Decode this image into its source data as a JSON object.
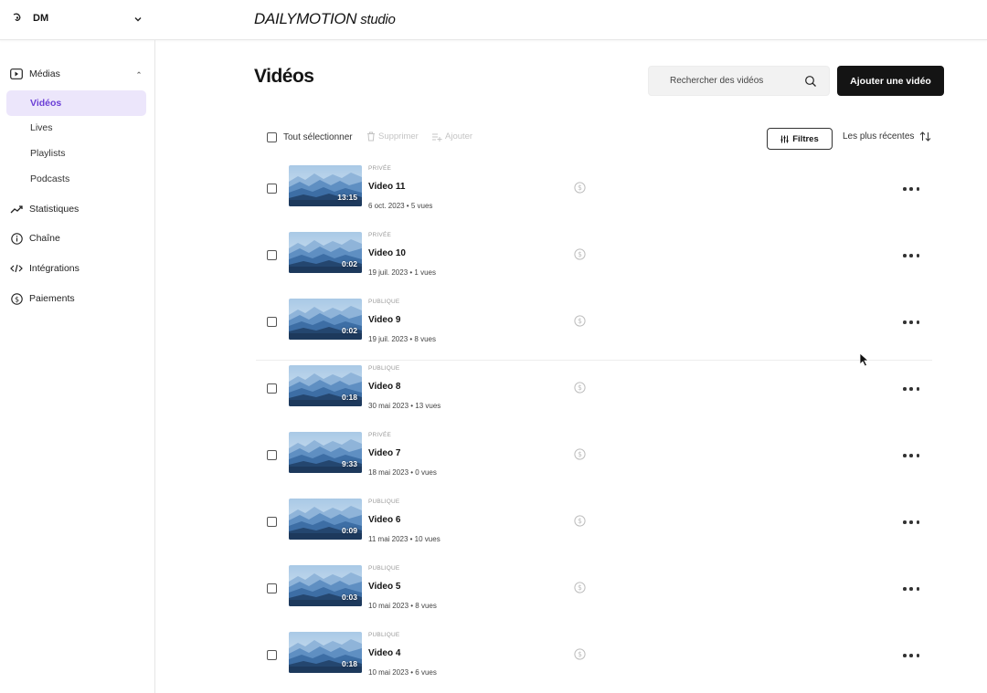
{
  "account": {
    "name": "DM",
    "logo_icon": "dailymotion-mark-icon"
  },
  "brand": {
    "part1": "DAILYMOTION",
    "part2": "studio"
  },
  "sidebar": {
    "items": [
      {
        "label": "Médias",
        "icon": "play-square-icon"
      },
      {
        "label": "Statistiques",
        "icon": "trend-up-icon"
      },
      {
        "label": "Chaîne",
        "icon": "info-circle-icon"
      },
      {
        "label": "Intégrations",
        "icon": "code-icon"
      },
      {
        "label": "Paiements",
        "icon": "dollar-circle-icon"
      }
    ],
    "sub_items": [
      {
        "label": "Vidéos",
        "active": true
      },
      {
        "label": "Lives"
      },
      {
        "label": "Playlists"
      },
      {
        "label": "Podcasts"
      }
    ]
  },
  "main": {
    "title": "Vidéos",
    "search_placeholder": "Rechercher des vidéos",
    "add_button": "Ajouter une vidéo",
    "toolbar": {
      "select_all": "Tout sélectionner",
      "delete": "Supprimer",
      "add": "Ajouter",
      "filters": "Filtres",
      "sort": "Les plus récentes"
    },
    "videos": [
      {
        "visibility": "PRIVÉE",
        "title": "Video 11",
        "meta": "6 oct. 2023 • 5 vues",
        "duration": "13:15"
      },
      {
        "visibility": "PRIVÉE",
        "title": "Video 10",
        "meta": "19 juil. 2023 • 1 vues",
        "duration": "0:02"
      },
      {
        "visibility": "PUBLIQUE",
        "title": "Video 9",
        "meta": "19 juil. 2023 • 8 vues",
        "duration": "0:02"
      },
      {
        "visibility": "PUBLIQUE",
        "title": "Video 8",
        "meta": "30 mai 2023 • 13 vues",
        "duration": "0:18"
      },
      {
        "visibility": "PRIVÉE",
        "title": "Video 7",
        "meta": "18 mai 2023 • 0 vues",
        "duration": "9:33"
      },
      {
        "visibility": "PUBLIQUE",
        "title": "Video 6",
        "meta": "11 mai 2023 • 10 vues",
        "duration": "0:09"
      },
      {
        "visibility": "PUBLIQUE",
        "title": "Video 5",
        "meta": "10 mai 2023 • 8 vues",
        "duration": "0:03"
      },
      {
        "visibility": "PUBLIQUE",
        "title": "Video 4",
        "meta": "10 mai 2023 • 6 vues",
        "duration": "0:18"
      }
    ]
  },
  "colors": {
    "accent": "#6b3fd6",
    "active_bg": "#ece6fb",
    "primary_button": "#141414"
  }
}
